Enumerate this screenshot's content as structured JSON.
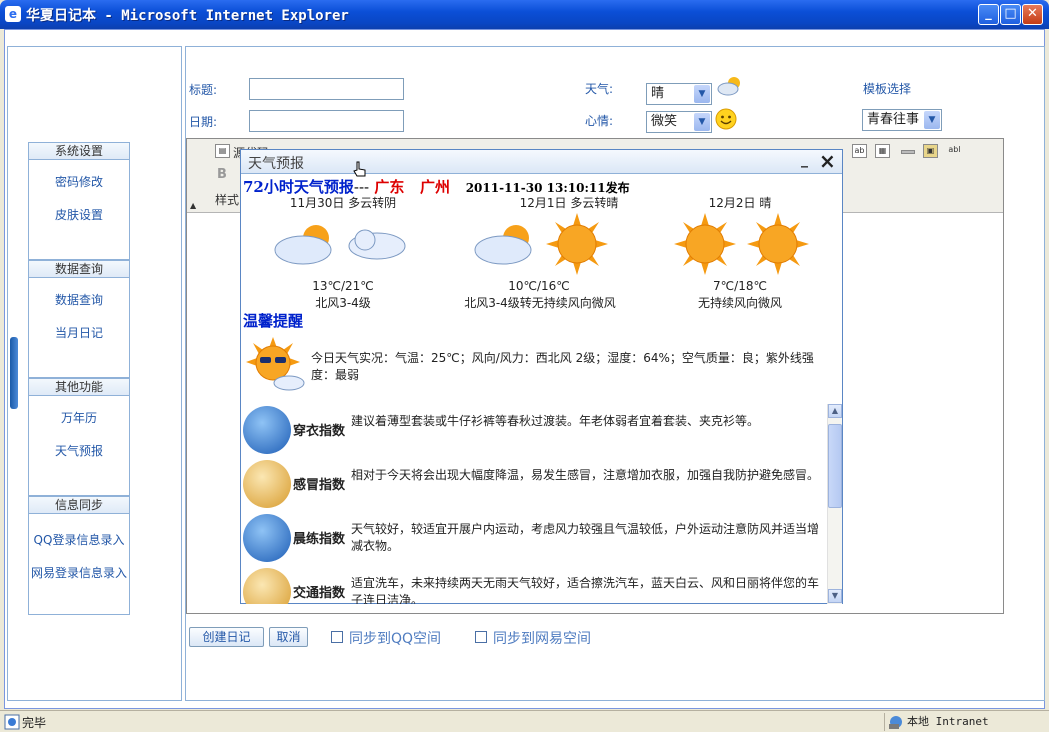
{
  "window": {
    "title": "华夏日记本 - Microsoft Internet Explorer",
    "buttons": [
      "minimize",
      "maximize",
      "close"
    ]
  },
  "sidebar": {
    "groups": [
      {
        "title": "系统设置",
        "items": [
          "密码修改",
          "皮肤设置"
        ]
      },
      {
        "title": "数据查询",
        "items": [
          "数据查询",
          "当月日记"
        ]
      },
      {
        "title": "其他功能",
        "items": [
          "万年历",
          "天气预报"
        ]
      },
      {
        "title": "信息同步",
        "items": [
          "QQ登录信息录入",
          "网易登录信息录入"
        ]
      }
    ]
  },
  "form": {
    "title_label": "标题:",
    "date_label": "日期:",
    "weather_label": "天气:",
    "weather_value": "晴",
    "mood_label": "心情:",
    "mood_value": "微笑",
    "template_label": "模板选择",
    "template_value": "青春往事"
  },
  "editor": {
    "source_label": "源代码",
    "bold_label": "B",
    "style_label": "样式"
  },
  "actions": {
    "create_label": "创建日记",
    "cancel_label": "取消",
    "sync_qq_label": "同步到QQ空间",
    "sync_163_label": "同步到网易空间"
  },
  "popup": {
    "title": "天气预报",
    "heading": "72小时天气预报",
    "dashes": "---",
    "province": "广东",
    "city": "广州",
    "published": "2011-11-30 13:10:11发布",
    "days": [
      {
        "date_weather": "11月30日  多云转阴",
        "temp": "13℃/21℃",
        "wind": "北风3-4级"
      },
      {
        "date_weather": "12月1日  多云转晴",
        "temp": "10℃/16℃",
        "wind": "北风3-4级转无持续风向微风"
      },
      {
        "date_weather": "12月2日  晴",
        "temp": "7℃/18℃",
        "wind": "无持续风向微风"
      }
    ],
    "reminder_title": "温馨提醒",
    "today_text": "今日天气实况：气温：25℃；风向/风力：西北风 2级；湿度：64%；空气质量：良；紫外线强度：最弱",
    "indices": [
      {
        "name": "穿衣指数",
        "desc": "建议着薄型套装或牛仔衫裤等春秋过渡装。年老体弱者宜着套装、夹克衫等。"
      },
      {
        "name": "感冒指数",
        "desc": "相对于今天将会出现大幅度降温，易发生感冒，注意增加衣服，加强自我防护避免感冒。"
      },
      {
        "name": "晨练指数",
        "desc": "天气较好，较适宜开展户内运动，考虑风力较强且气温较低，户外运动注意防风并适当增减衣物。"
      },
      {
        "name": "交通指数",
        "desc": "适宜洗车，未来持续两天无雨天气较好，适合擦洗汽车，蓝天白云、风和日丽将伴您的车子连日洁净。"
      }
    ]
  },
  "statusbar": {
    "status": "完毕",
    "zone": "本地 Intranet"
  },
  "colors": {
    "link_blue": "#2458a8",
    "heading_blue": "#0022cc",
    "location_red": "#dd0000",
    "titlebar_blue": "#0b4fd7"
  }
}
